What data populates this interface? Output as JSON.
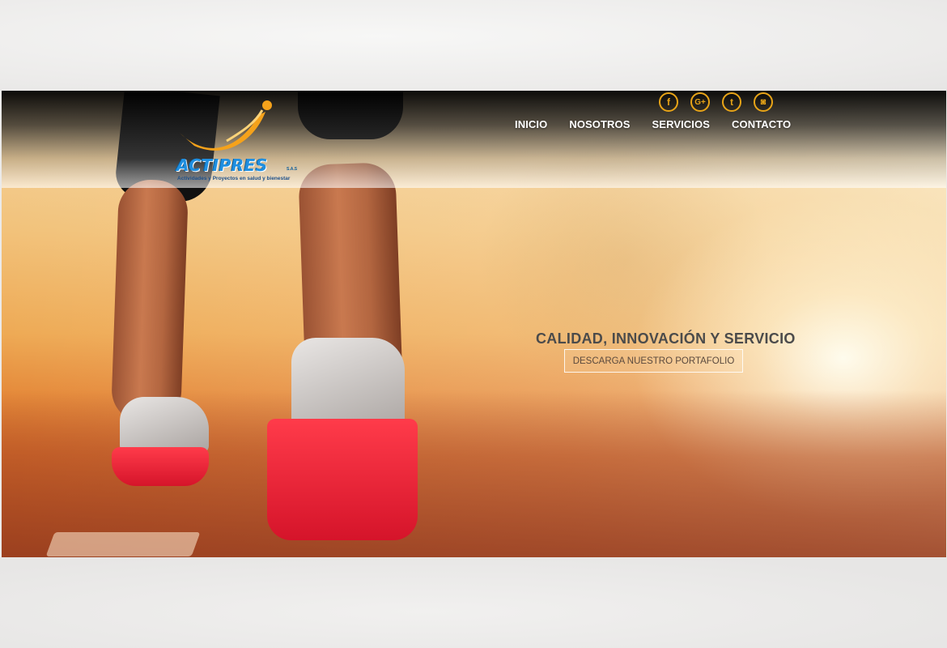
{
  "brand": {
    "name": "ACTIPRES",
    "suffix": "S.A.S",
    "tagline": "Actividades y Proyectos en salud y bienestar",
    "colors": {
      "primary_blue": "#1f8fe0",
      "accent_orange": "#f5a21b"
    }
  },
  "social": [
    {
      "name": "facebook",
      "glyph": "f"
    },
    {
      "name": "google-plus",
      "glyph": "G+"
    },
    {
      "name": "twitter",
      "glyph": "t"
    },
    {
      "name": "instagram",
      "glyph": "◙"
    }
  ],
  "nav": {
    "items": [
      {
        "label": "INICIO"
      },
      {
        "label": "NOSOTROS"
      },
      {
        "label": "SERVICIOS"
      },
      {
        "label": "CONTACTO"
      }
    ]
  },
  "hero": {
    "title": "CALIDAD, INNOVACIÓN Y SERVICIO",
    "cta_label": "DESCARGA NUESTRO PORTAFOLIO"
  }
}
